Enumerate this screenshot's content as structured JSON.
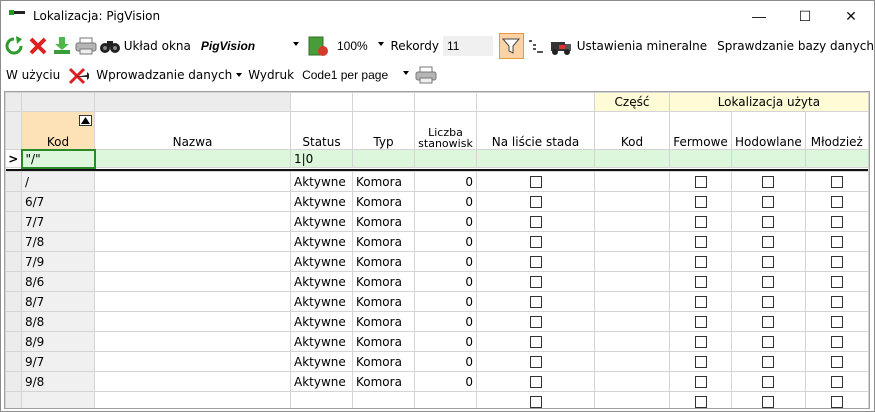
{
  "window": {
    "title": "Lokalizacja: PigVision",
    "controls": {
      "minimize": "—",
      "maximize": "☐",
      "close": "✕"
    }
  },
  "toolbar": {
    "layout_label": "Układ okna",
    "layout_value": "PigVision",
    "zoom_value": "100%",
    "records_label": "Rekordy",
    "records_value": "11",
    "mineral_settings": "Ustawienia mineralne",
    "db_check": "Sprawdzanie bazy danych"
  },
  "toolbar2": {
    "in_use": "W użyciu",
    "data_entry": "Wprowadzanie danych",
    "print_label": "Wydruk",
    "print_value": "Code1 per page"
  },
  "grid": {
    "group_headers": {
      "part": "Część",
      "location_used": "Lokalizacja użyta"
    },
    "columns": {
      "kod": "Kod",
      "nazwa": "Nazwa",
      "status": "Status",
      "typ": "Typ",
      "liczba": "Liczba stanowisk",
      "na_liscie": "Na liście stada",
      "czesc_kod": "Kod",
      "fermowe": "Fermowe",
      "hodowlane": "Hodowlane",
      "mlodziez": "Młodzież"
    },
    "filter_row": {
      "marker": ">",
      "kod": "\"/\"",
      "status": "1|0"
    },
    "rows": [
      {
        "kod": "/",
        "status": "Aktywne",
        "typ": "Komora",
        "liczba": "0"
      },
      {
        "kod": "6/7",
        "status": "Aktywne",
        "typ": "Komora",
        "liczba": "0"
      },
      {
        "kod": "7/7",
        "status": "Aktywne",
        "typ": "Komora",
        "liczba": "0"
      },
      {
        "kod": "7/8",
        "status": "Aktywne",
        "typ": "Komora",
        "liczba": "0"
      },
      {
        "kod": "7/9",
        "status": "Aktywne",
        "typ": "Komora",
        "liczba": "0"
      },
      {
        "kod": "8/6",
        "status": "Aktywne",
        "typ": "Komora",
        "liczba": "0"
      },
      {
        "kod": "8/7",
        "status": "Aktywne",
        "typ": "Komora",
        "liczba": "0"
      },
      {
        "kod": "8/8",
        "status": "Aktywne",
        "typ": "Komora",
        "liczba": "0"
      },
      {
        "kod": "8/9",
        "status": "Aktywne",
        "typ": "Komora",
        "liczba": "0"
      },
      {
        "kod": "9/7",
        "status": "Aktywne",
        "typ": "Komora",
        "liczba": "0"
      },
      {
        "kod": "9/8",
        "status": "Aktywne",
        "typ": "Komora",
        "liczba": "0"
      }
    ]
  },
  "colors": {
    "filter_row_bg": "#dcf7dc",
    "group_header_bg": "#fffbd6",
    "kod_header_bg": "#fde2b8",
    "filter_button_bg": "#fbd3a4"
  }
}
